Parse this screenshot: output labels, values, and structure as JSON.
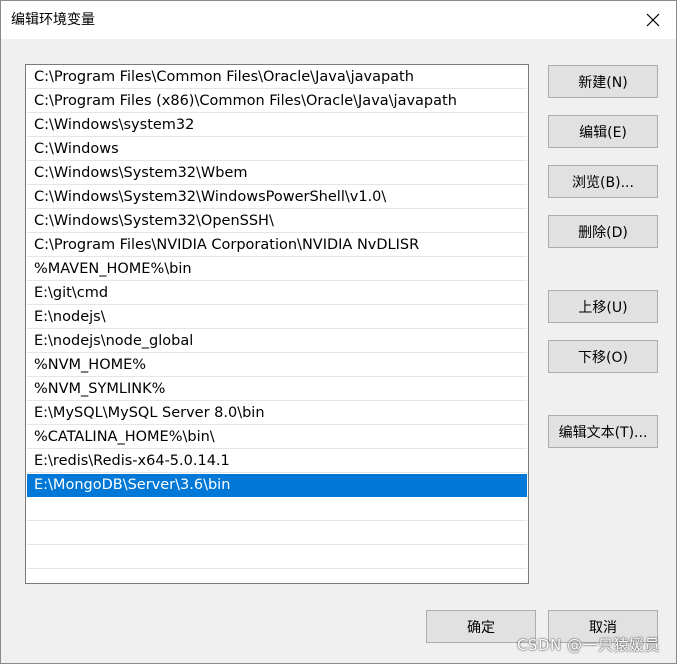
{
  "window": {
    "title": "编辑环境变量",
    "close_icon": "close-icon"
  },
  "path_entries": [
    "C:\\Program Files\\Common Files\\Oracle\\Java\\javapath",
    "C:\\Program Files (x86)\\Common Files\\Oracle\\Java\\javapath",
    "C:\\Windows\\system32",
    "C:\\Windows",
    "C:\\Windows\\System32\\Wbem",
    "C:\\Windows\\System32\\WindowsPowerShell\\v1.0\\",
    "C:\\Windows\\System32\\OpenSSH\\",
    "C:\\Program Files\\NVIDIA Corporation\\NVIDIA NvDLISR",
    "%MAVEN_HOME%\\bin",
    "E:\\git\\cmd",
    "E:\\nodejs\\",
    "E:\\nodejs\\node_global",
    "%NVM_HOME%",
    "%NVM_SYMLINK%",
    "E:\\MySQL\\MySQL Server 8.0\\bin",
    "%CATALINA_HOME%\\bin\\",
    "E:\\redis\\Redis-x64-5.0.14.1",
    "E:\\MongoDB\\Server\\3.6\\bin"
  ],
  "selected_index": 17,
  "empty_rows": 4,
  "buttons": {
    "new": "新建(N)",
    "edit": "编辑(E)",
    "browse": "浏览(B)...",
    "delete": "删除(D)",
    "move_up": "上移(U)",
    "move_down": "下移(O)",
    "edit_text": "编辑文本(T)...",
    "ok": "确定",
    "cancel": "取消"
  },
  "watermark": "CSDN @一只猿媛员",
  "colors": {
    "selection": "#0078d7",
    "button_face": "#e1e1e1",
    "dialog_bg": "#f0f0f0"
  }
}
